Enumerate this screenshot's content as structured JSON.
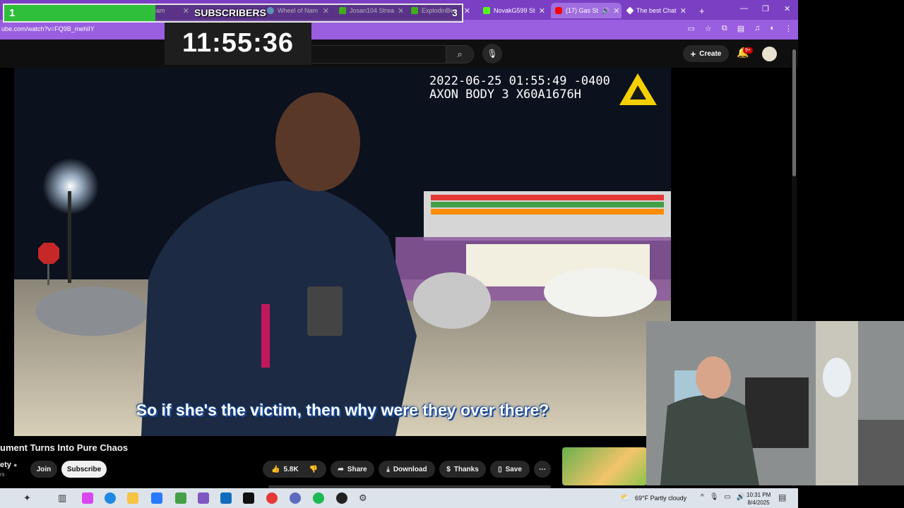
{
  "browser": {
    "tabs": [
      {
        "title": "eam",
        "color": "#ffffff"
      },
      {
        "title": "Wheel of Nam",
        "color": "#7fd3ff"
      },
      {
        "title": "Josan104 Strea",
        "color": "#53fc18"
      },
      {
        "title": "ExplodinBee",
        "color": "#53fc18"
      },
      {
        "title": "NovakG599 St",
        "color": "#53fc18"
      },
      {
        "title": "(17) Gas St",
        "color": "#ff0000"
      },
      {
        "title": "The best Chat",
        "color": "#ffffff"
      }
    ],
    "url": "ube.com/watch?v=FQ9B_mehiIY",
    "new_tab_glyph": "+"
  },
  "overlay": {
    "subs_goal": "1",
    "subs_label": "SUBSCRIBERS",
    "subs_current": "3",
    "subs_progress_fraction": 0.33,
    "timer": "11:55:36"
  },
  "youtube": {
    "create_label": "Create",
    "notification_badge": "9+",
    "video": {
      "bodycam_timestamp": "2022-06-25 01:55:49 -0400",
      "bodycam_device": "AXON BODY 3 X60A1676H",
      "subtitle": "So if she's the victim, then why were they over there?"
    },
    "title": "ument Turns Into Pure Chaos",
    "channel": "ety",
    "channel_subs": "rs",
    "join_label": "Join",
    "subscribe_label": "Subscribe",
    "likes": "5.8K",
    "share_label": "Share",
    "download_label": "Download",
    "thanks_label": "Thanks",
    "save_label": "Save"
  },
  "taskbar": {
    "weather": "69°F  Partly cloudy",
    "time": "10:31 PM",
    "date": "8/4/2025"
  },
  "colors": {
    "tab_strip": "#7b3fc4",
    "address_bar": "#9a5ee0",
    "progress_green": "#2fbf3a",
    "subtitle_outline": "#1d4fa3",
    "axon_yellow": "#f5d000"
  }
}
